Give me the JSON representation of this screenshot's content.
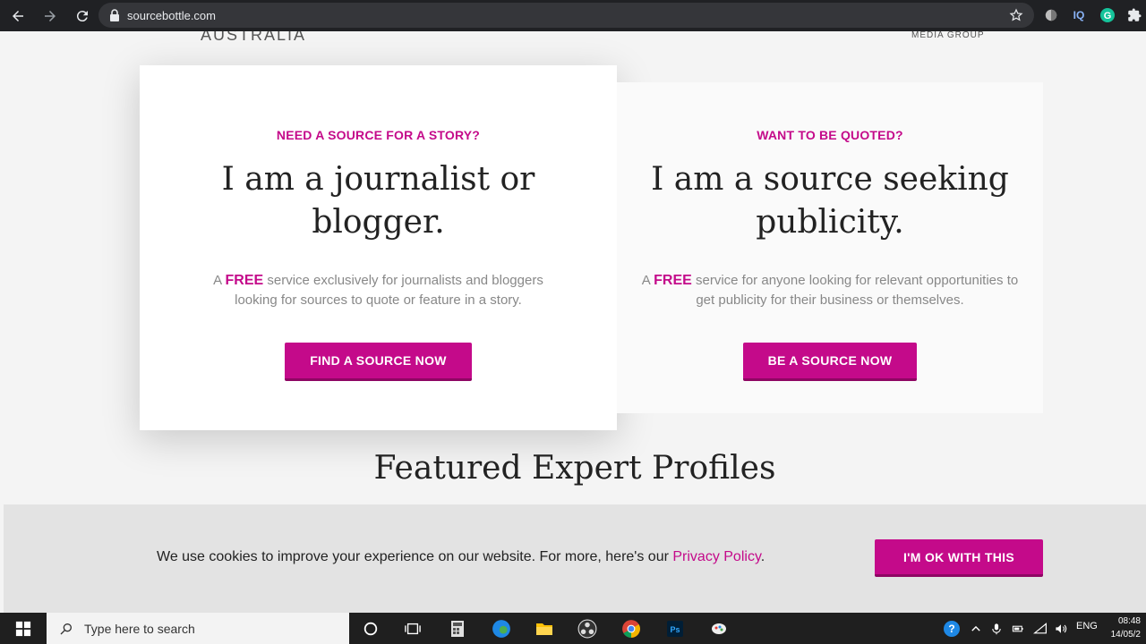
{
  "browser": {
    "url": "sourcebottle.com"
  },
  "header": {
    "logo_left_fragment": "AUSTRALIA",
    "logo_right_fragment": "MEDIA GROUP"
  },
  "cards": {
    "journalist": {
      "eyebrow": "NEED A SOURCE FOR A STORY?",
      "headline": "I am a journalist or blogger.",
      "desc_prefix": "A ",
      "desc_free": "FREE",
      "desc_rest": " service exclusively for journalists and bloggers looking for sources to quote or feature in a story.",
      "cta": "FIND A SOURCE NOW"
    },
    "source": {
      "eyebrow": "WANT TO BE QUOTED?",
      "headline": "I am a source seeking publicity.",
      "desc_prefix": "A ",
      "desc_free": "FREE",
      "desc_rest": " service for anyone looking for relevant opportunities to get publicity for their business or themselves.",
      "cta": "BE A SOURCE NOW"
    }
  },
  "section": {
    "featured_title": "Featured Expert Profiles"
  },
  "cookie": {
    "text": "We use cookies to improve your experience on our website. For more, here's our ",
    "link": "Privacy Policy",
    "suffix": ".",
    "button": "I'M OK WITH THIS"
  },
  "taskbar": {
    "search_placeholder": "Type here to search",
    "language": "ENG",
    "time": "08:48",
    "date": "14/05/2"
  },
  "colors": {
    "brand": "#c40a8a"
  }
}
